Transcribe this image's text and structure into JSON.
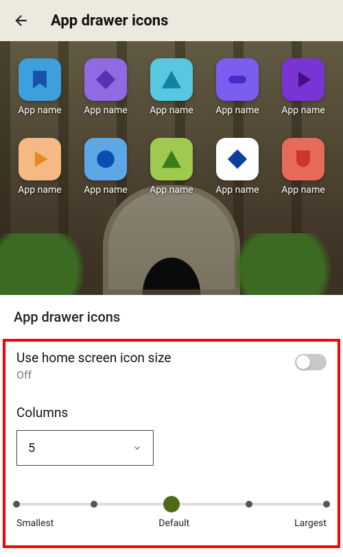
{
  "header": {
    "title": "App drawer icons"
  },
  "preview": {
    "apps": [
      {
        "label": "App name",
        "tile": "#3e9fdd",
        "shape": "bookmark",
        "shape_color": "#1552a8"
      },
      {
        "label": "App name",
        "tile": "#8e6ae3",
        "shape": "diamond",
        "shape_color": "#5a2fb6"
      },
      {
        "label": "App name",
        "tile": "#57c8e0",
        "shape": "triangle",
        "shape_color": "#1083a4"
      },
      {
        "label": "App name",
        "tile": "#7b5ef0",
        "shape": "pill",
        "shape_color": "#4b28c9"
      },
      {
        "label": "App name",
        "tile": "#7a34d6",
        "shape": "play",
        "shape_color": "#3f107f"
      },
      {
        "label": "App name",
        "tile": "#f5b985",
        "shape": "play",
        "shape_color": "#e68a1e"
      },
      {
        "label": "App name",
        "tile": "#5ea7e6",
        "shape": "circle",
        "shape_color": "#0a4fb0"
      },
      {
        "label": "App name",
        "tile": "#9fca4f",
        "shape": "triangle",
        "shape_color": "#3a7d1b"
      },
      {
        "label": "App name",
        "tile": "#ffffff",
        "shape": "diamond",
        "shape_color": "#0a3fa0"
      },
      {
        "label": "App name",
        "tile": "#e86a5a",
        "shape": "shield",
        "shape_color": "#c9382a"
      }
    ]
  },
  "section": {
    "title": "App drawer icons"
  },
  "settings": {
    "use_home_size": {
      "title": "Use home screen icon size",
      "state_label": "Off",
      "on": false
    },
    "columns": {
      "label": "Columns",
      "value": "5"
    },
    "slider": {
      "min_label": "Smallest",
      "mid_label": "Default",
      "max_label": "Largest",
      "stops": 5,
      "value_index": 2
    }
  }
}
